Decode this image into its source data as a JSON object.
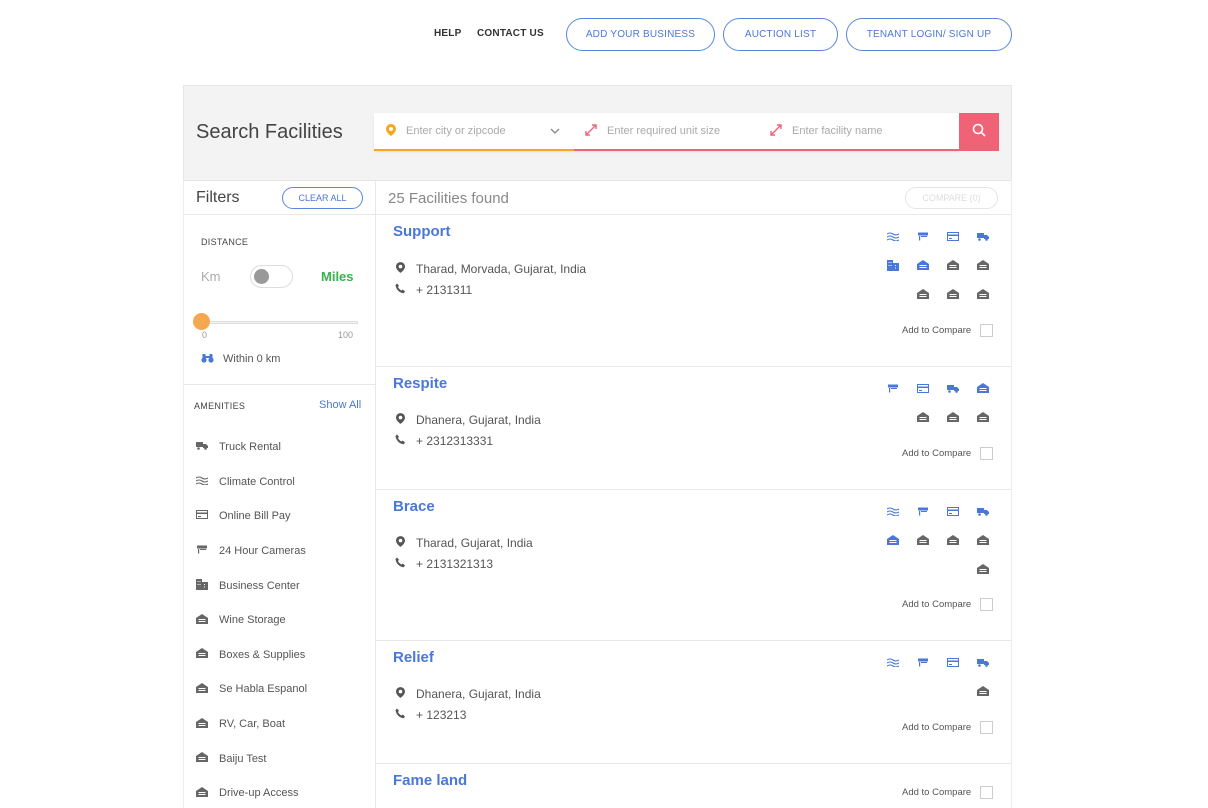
{
  "nav": {
    "help": "HELP",
    "contact": "CONTACT US",
    "add_business": "ADD YOUR BUSINESS",
    "auction": "AUCTION LIST",
    "tenant": "TENANT LOGIN/ SIGN UP"
  },
  "search": {
    "title": "Search Facilities",
    "city_placeholder": "Enter city or zipcode",
    "unit_placeholder": "Enter required unit size",
    "name_placeholder": "Enter facility name"
  },
  "filters": {
    "title": "Filters",
    "clear_all": "CLEAR ALL",
    "distance_label": "DISTANCE",
    "km": "Km",
    "miles": "Miles",
    "slider_min": "0",
    "slider_max": "100",
    "slider_value": 0,
    "within": "Within 0 km",
    "amenities_label": "AMENITIES",
    "show_all": "Show All",
    "amenities": [
      {
        "label": "Truck Rental",
        "icon": "truck-icon"
      },
      {
        "label": "Climate Control",
        "icon": "climate-icon"
      },
      {
        "label": "Online Bill Pay",
        "icon": "bill-icon"
      },
      {
        "label": "24 Hour Cameras",
        "icon": "camera-icon"
      },
      {
        "label": "Business Center",
        "icon": "building-icon"
      },
      {
        "label": "Wine Storage",
        "icon": "storage-icon"
      },
      {
        "label": "Boxes & Supplies",
        "icon": "storage-icon"
      },
      {
        "label": "Se Habla Espanol",
        "icon": "storage-icon"
      },
      {
        "label": "RV, Car, Boat",
        "icon": "storage-icon"
      },
      {
        "label": "Baiju Test",
        "icon": "storage-icon"
      },
      {
        "label": "Drive-up Access",
        "icon": "storage-icon"
      }
    ]
  },
  "results": {
    "count_text": "25 Facilities found",
    "compare_btn": "COMPARE (0)",
    "add_to_compare": "Add to Compare",
    "facilities": [
      {
        "name": "Support",
        "address": "Tharad, Morvada, Gujarat, India",
        "phone": "+ 2131311"
      },
      {
        "name": "Respite",
        "address": "Dhanera, Gujarat, India",
        "phone": "+ 2312313331"
      },
      {
        "name": "Brace",
        "address": "Tharad, Gujarat, India",
        "phone": "+ 2131321313"
      },
      {
        "name": "Relief",
        "address": "Dhanera, Gujarat, India",
        "phone": "+ 123213"
      },
      {
        "name": "Fame land",
        "address": "",
        "phone": ""
      }
    ]
  },
  "colors": {
    "accent": "#4a78d8",
    "search_btn": "#f06275",
    "miles_green": "#37b24d",
    "slider_orange": "#f5a850"
  }
}
